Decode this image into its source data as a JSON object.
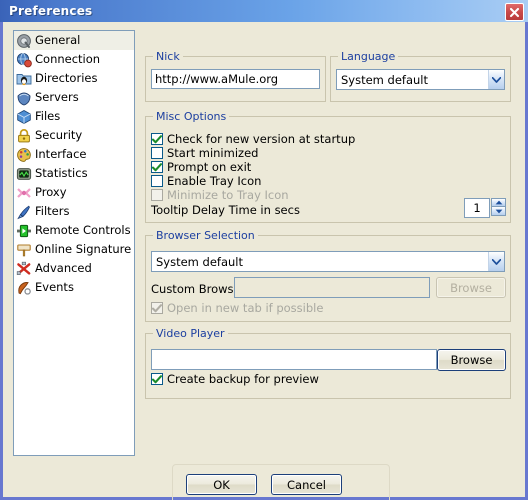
{
  "window": {
    "title": "Preferences",
    "close_icon": "close-icon",
    "accent_title_color": "#6aa3e8",
    "frame_color": "#6878d0",
    "face_color": "#ece9d8",
    "legend_color": "#1c3fa0"
  },
  "sidebar": {
    "items": [
      {
        "label": "General",
        "icon": "general-icon",
        "selected": true
      },
      {
        "label": "Connection",
        "icon": "connection-icon",
        "selected": false
      },
      {
        "label": "Directories",
        "icon": "directories-icon",
        "selected": false
      },
      {
        "label": "Servers",
        "icon": "servers-icon",
        "selected": false
      },
      {
        "label": "Files",
        "icon": "files-icon",
        "selected": false
      },
      {
        "label": "Security",
        "icon": "security-lock-icon",
        "selected": false
      },
      {
        "label": "Interface",
        "icon": "interface-palette-icon",
        "selected": false
      },
      {
        "label": "Statistics",
        "icon": "statistics-icon",
        "selected": false
      },
      {
        "label": "Proxy",
        "icon": "proxy-icon",
        "selected": false
      },
      {
        "label": "Filters",
        "icon": "filters-brush-icon",
        "selected": false
      },
      {
        "label": "Remote Controls",
        "icon": "remote-controls-icon",
        "selected": false
      },
      {
        "label": "Online Signature",
        "icon": "online-signature-icon",
        "selected": false
      },
      {
        "label": "Advanced",
        "icon": "advanced-icon",
        "selected": false
      },
      {
        "label": "Events",
        "icon": "events-icon",
        "selected": false
      }
    ]
  },
  "nick": {
    "legend": "Nick",
    "value": "http://www.aMule.org"
  },
  "language": {
    "legend": "Language",
    "value": "System default"
  },
  "misc_options": {
    "legend": "Misc Options",
    "checkboxes": [
      {
        "label": "Check for new version at startup",
        "checked": true,
        "enabled": true
      },
      {
        "label": "Start minimized",
        "checked": false,
        "enabled": true
      },
      {
        "label": "Prompt on exit",
        "checked": true,
        "enabled": true
      },
      {
        "label": "Enable Tray Icon",
        "checked": false,
        "enabled": true
      },
      {
        "label": "Minimize to Tray Icon",
        "checked": false,
        "enabled": false
      }
    ],
    "tooltip_delay_label": "Tooltip Delay Time in secs",
    "tooltip_delay_value": "1"
  },
  "browser_selection": {
    "legend": "Browser Selection",
    "combo_value": "System default",
    "custom_browser_label": "Custom Browser:",
    "custom_browser_value": "",
    "browse_button": "Browse",
    "browse_enabled": false,
    "new_tab_label": "Open in new tab if possible",
    "new_tab_checked": true,
    "new_tab_enabled": false
  },
  "video_player": {
    "legend": "Video Player",
    "path_value": "",
    "browse_button": "Browse",
    "backup_label": "Create backup for preview",
    "backup_checked": true
  },
  "footer": {
    "ok_label": "OK",
    "cancel_label": "Cancel"
  }
}
